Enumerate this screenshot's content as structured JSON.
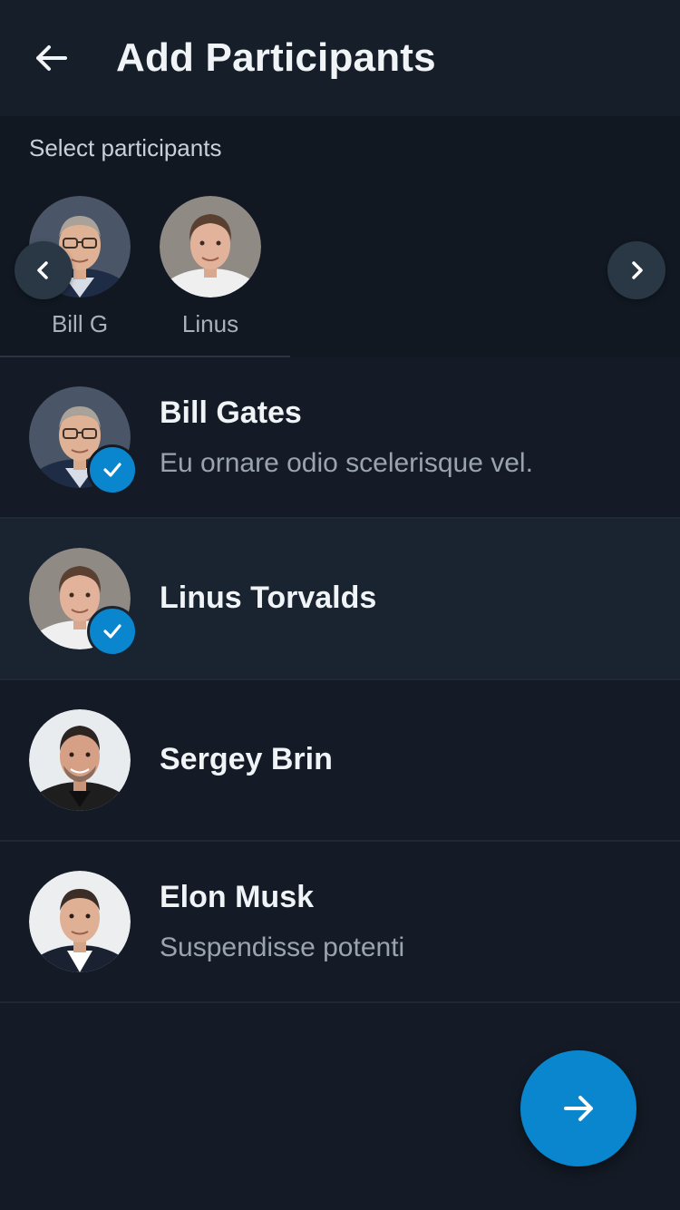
{
  "header": {
    "title": "Add Participants",
    "back_icon": "arrow-left-icon"
  },
  "selected": {
    "label": "Select participants",
    "chips": [
      {
        "name": "Bill G",
        "avatar": "bill-gates-avatar"
      },
      {
        "name": "Linus",
        "avatar": "linus-torvalds-avatar"
      }
    ],
    "prev_icon": "chevron-left-icon",
    "next_icon": "chevron-right-icon"
  },
  "contacts": [
    {
      "name": "Bill Gates",
      "status": "Eu ornare odio scelerisque vel.",
      "selected": true,
      "highlighted": false
    },
    {
      "name": "Linus Torvalds",
      "status": "",
      "selected": true,
      "highlighted": true
    },
    {
      "name": "Sergey Brin",
      "status": "",
      "selected": false,
      "highlighted": false
    },
    {
      "name": "Elon Musk",
      "status": "Suspendisse potenti",
      "selected": false,
      "highlighted": false
    }
  ],
  "fab": {
    "icon": "arrow-right-icon"
  },
  "colors": {
    "background": "#141b26",
    "header": "#161e29",
    "accent": "#0a86cf",
    "row_highlight": "#1a2430"
  }
}
